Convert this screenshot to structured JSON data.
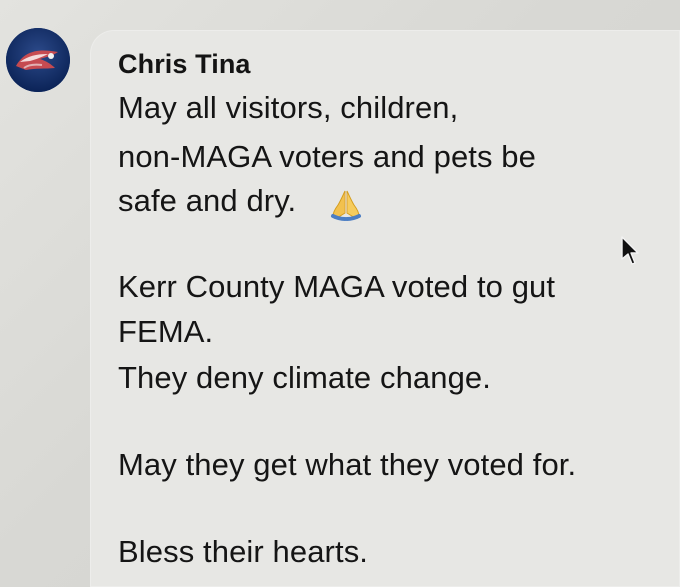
{
  "post": {
    "author": "Chris Tina",
    "lines": [
      "May all visitors, children,",
      "non-MAGA voters and pets be",
      "safe and dry.",
      "Kerr County MAGA voted to gut",
      "FEMA.",
      "They deny climate change.",
      "May they get what they voted for.",
      "Bless their hearts."
    ],
    "emoji": "praying-hands",
    "cursor": "mouse-pointer"
  }
}
